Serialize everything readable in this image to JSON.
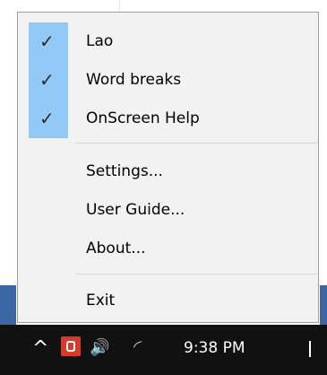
{
  "menu": {
    "items": [
      {
        "label": "Lao",
        "checked": true
      },
      {
        "label": "Word breaks",
        "checked": true
      },
      {
        "label": "OnScreen Help",
        "checked": true
      },
      {
        "label": "Settings...",
        "checked": false
      },
      {
        "label": "User Guide...",
        "checked": false
      },
      {
        "label": "About...",
        "checked": false
      },
      {
        "label": "Exit",
        "checked": false
      }
    ],
    "check_glyph": "✓"
  },
  "taskbar": {
    "chevron_glyph": "^",
    "volume_glyph": "🔊",
    "wifi_glyph": "◜",
    "time": "9:38 PM"
  },
  "colors": {
    "menu_bg": "#f2f2f2",
    "check_bg": "#91c9f7",
    "taskbar_bg": "#111111",
    "desktop_blue": "#3a66a4",
    "app_icon_red": "#d83b2b"
  },
  "icons": [
    "check-icon",
    "chevron-up-icon",
    "app-tray-icon",
    "volume-icon",
    "wifi-icon"
  ]
}
